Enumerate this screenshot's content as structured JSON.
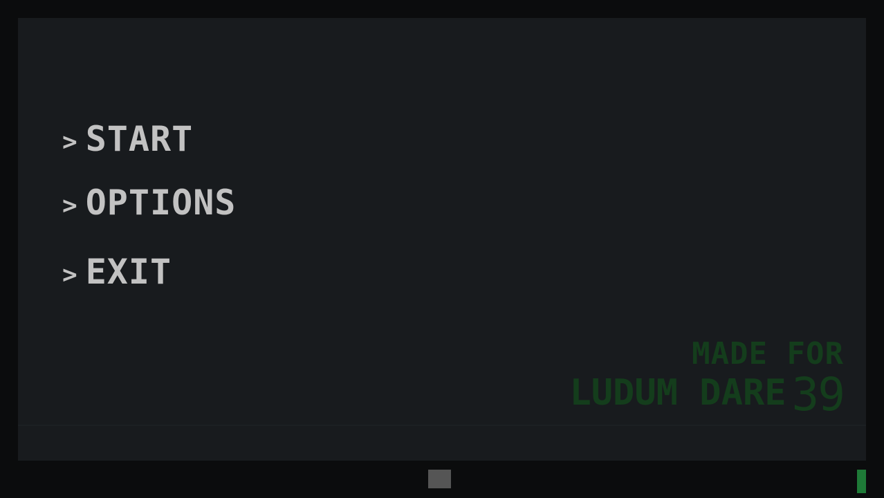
{
  "menu": {
    "arrow": ">",
    "items": [
      {
        "label": "START"
      },
      {
        "label": "OPTIONS"
      },
      {
        "label": "EXIT"
      }
    ]
  },
  "credit": {
    "line1": "MADE FOR",
    "line2": "LUDUM DARE",
    "number": "39"
  },
  "colors": {
    "menu_text": "#c2c2c2",
    "credit_text": "#143d1c",
    "screen_bg": "#181b1e",
    "frame_bg": "#0b0c0d",
    "status_square": "#555555",
    "status_bar": "#1e7a37"
  }
}
